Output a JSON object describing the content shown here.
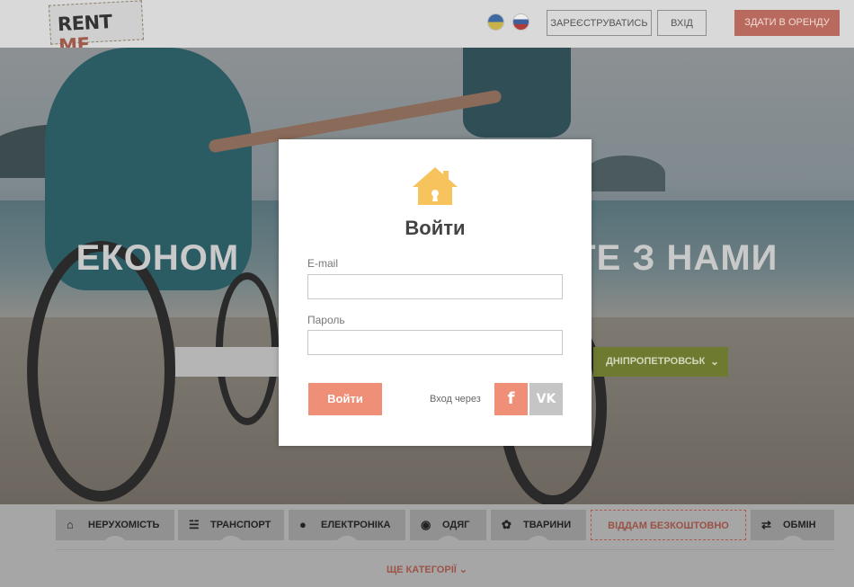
{
  "header": {
    "logo_text_a": "RENT",
    "logo_text_b": "ME",
    "languages": [
      "ua-flag-icon",
      "ru-flag-icon"
    ],
    "register_label": "ЗАРЕЄСТРУВАТИСЬ",
    "login_label": "ВХІД",
    "rent_out_label": "ЗДАТИ В ОРЕНДУ"
  },
  "hero": {
    "title": "ЕКОНОМТЕ З НАМИ",
    "title_left": "ЕКОНОМ",
    "title_right": "ТЕ З НАМИ",
    "city_label": "ДНІПРОПЕТРОВСЬК"
  },
  "modal": {
    "title": "Войти",
    "email_label": "E-mail",
    "email_value": "",
    "password_label": "Пароль",
    "password_value": "",
    "submit_label": "Войти",
    "via_label": "Вход через",
    "facebook_glyph": "f",
    "vk_glyph": "VK"
  },
  "categories": [
    {
      "label": "НЕРУХОМІСТЬ",
      "icon": "home-icon"
    },
    {
      "label": "ТРАНСПОРТ",
      "icon": "scooter-icon"
    },
    {
      "label": "ЕЛЕКТРОНІКА",
      "icon": "electronics-icon"
    },
    {
      "label": "ОДЯГ",
      "icon": "clothes-button-icon"
    },
    {
      "label": "ТВАРИНИ",
      "icon": "paw-icon"
    },
    {
      "label": "ВІДДАМ БЕЗКОШТОВНО",
      "icon": ""
    },
    {
      "label": "ОБМІН",
      "icon": "shuffle-icon"
    }
  ],
  "more_categories_label": "ЩЕ КАТЕГОРІЇ",
  "colors": {
    "accent": "#f08f78",
    "city_green": "#8bc34a",
    "text_dark": "#444444"
  }
}
